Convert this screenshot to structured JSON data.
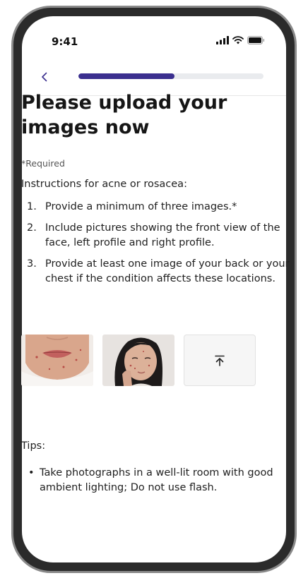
{
  "status_bar": {
    "time": "9:41"
  },
  "header": {
    "back_icon": "chevron-left-icon",
    "progress": 0.52,
    "progress_color": "#3b2f8f",
    "track_color": "#e9ebee"
  },
  "page": {
    "title_line1": "Please upload your",
    "title_line2": "images now",
    "required_note": "*Required",
    "instructions_heading": "Instructions for acne or rosacea:",
    "instructions": [
      {
        "num": "1.",
        "text": "Provide a minimum of three images.*"
      },
      {
        "num": "2.",
        "text": "Include pictures showing the front view of the face, left profile and right profile."
      },
      {
        "num": "3.",
        "text": "Provide at least one image of your back or your chest if the condition affects these locations."
      }
    ]
  },
  "uploads": {
    "images": [
      "lower-face-photo",
      "profile-face-photo"
    ],
    "upload_icon": "upload-arrow-icon"
  },
  "tips": {
    "heading": "Tips:",
    "items": [
      {
        "bullet": "•",
        "text": "Take photographs in a well-lit room with good ambient lighting; Do not use flash."
      }
    ]
  }
}
